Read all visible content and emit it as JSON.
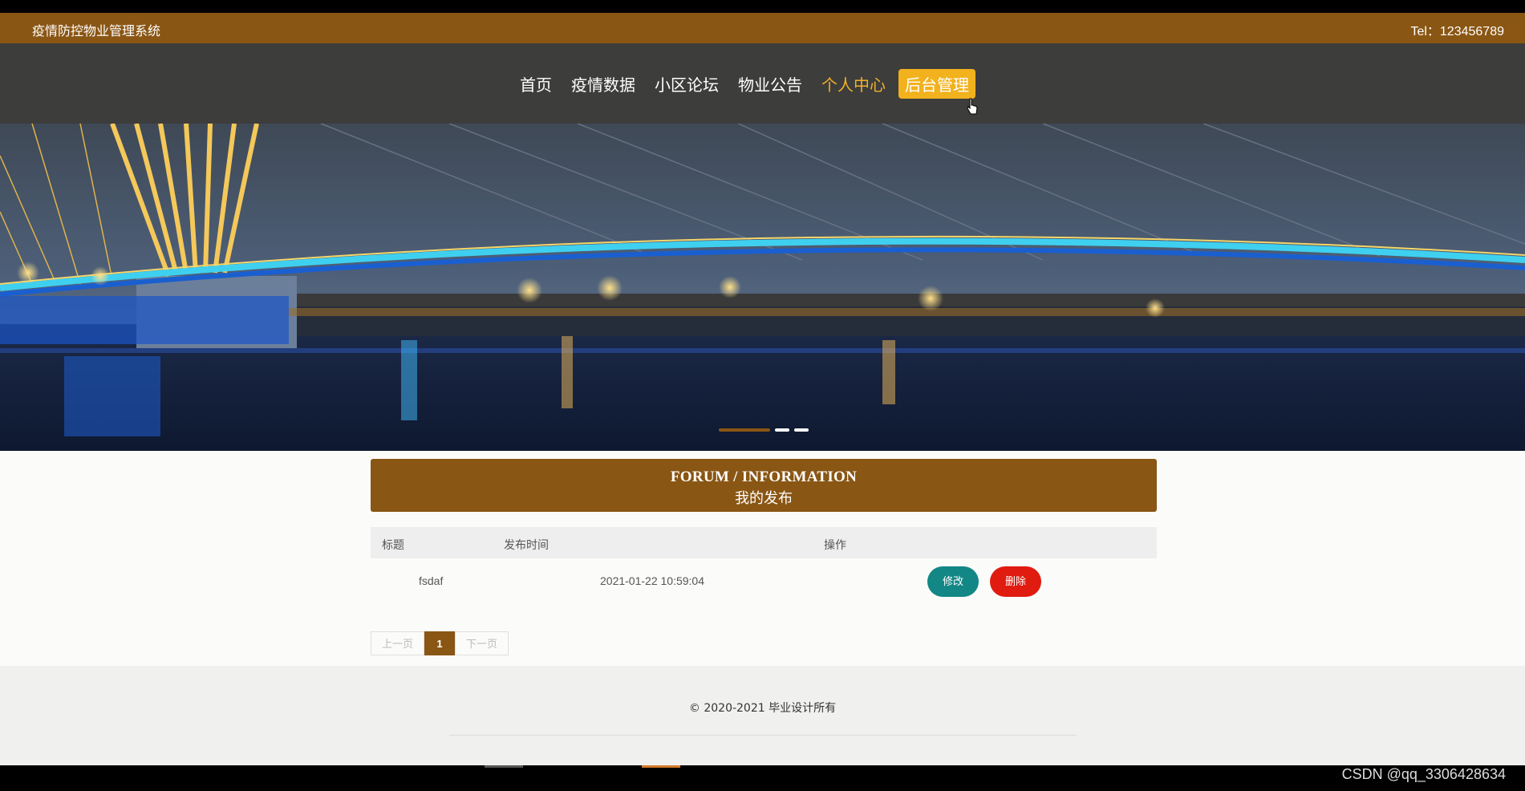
{
  "topbar": {
    "site_name": "疫情防控物业管理系统",
    "tel": "Tel：123456789"
  },
  "nav": {
    "items": [
      {
        "label": "首页"
      },
      {
        "label": "疫情数据"
      },
      {
        "label": "小区论坛"
      },
      {
        "label": "物业公告"
      },
      {
        "label": "个人中心"
      },
      {
        "label": "后台管理"
      }
    ]
  },
  "banner": {
    "slides": 3,
    "active_slide": 1
  },
  "section": {
    "title_en": "FORUM / INFORMATION",
    "title_zh": "我的发布"
  },
  "table": {
    "headers": [
      "标题",
      "发布时间",
      "操作"
    ],
    "rows": [
      {
        "title": "fsdaf",
        "time": "2021-01-22 10:59:04",
        "edit_label": "修改",
        "delete_label": "删除"
      }
    ]
  },
  "pager": {
    "prev": "上一页",
    "current": "1",
    "next": "下一页"
  },
  "footer": {
    "copyright": "© 2020-2021 毕业设计所有"
  },
  "watermark": "CSDN @qq_3306428634",
  "colors": {
    "brand": "#8a5614",
    "nav_bg": "#3d3d3b",
    "accent": "#f2b21d",
    "edit": "#128785",
    "delete": "#e01b10"
  }
}
